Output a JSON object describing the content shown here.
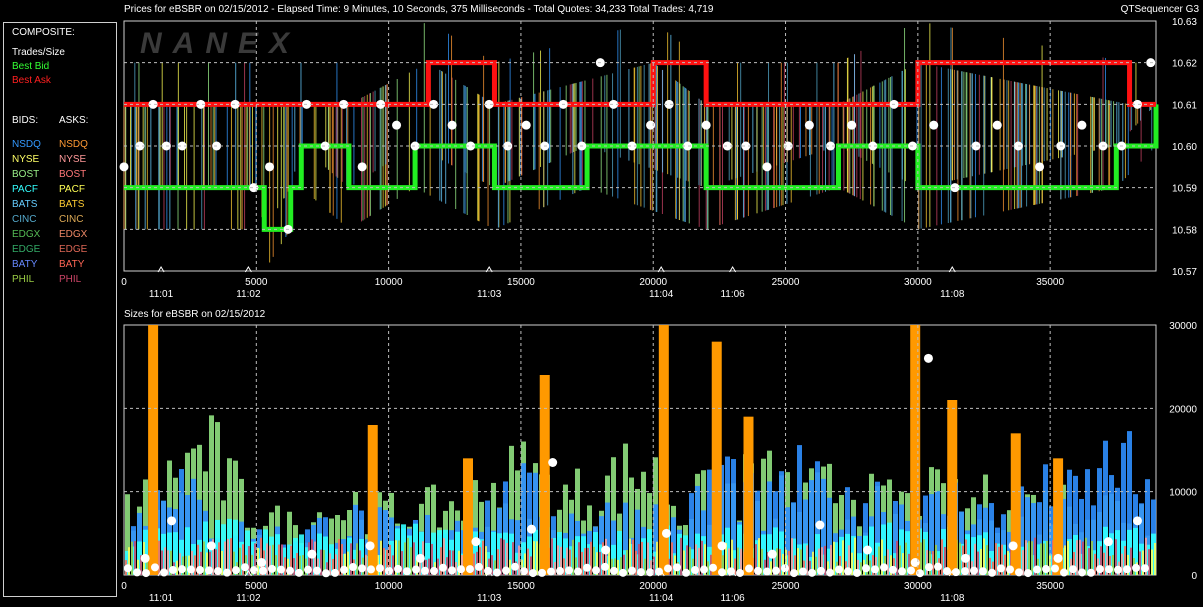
{
  "legend": {
    "composite_title": "COMPOSITE:",
    "items": [
      {
        "label": "Trades/Size",
        "color": "#ffffff"
      },
      {
        "label": "Best Bid",
        "color": "#33ff33"
      },
      {
        "label": "Best Ask",
        "color": "#ff2020"
      }
    ],
    "bids_title": "BIDS:",
    "asks_title": "ASKS:",
    "bids": [
      {
        "label": "NSDQ",
        "color": "#3399ff"
      },
      {
        "label": "NYSE",
        "color": "#ffff66"
      },
      {
        "label": "BOST",
        "color": "#99ee88"
      },
      {
        "label": "PACF",
        "color": "#33ffff"
      },
      {
        "label": "BATS",
        "color": "#66ccff"
      },
      {
        "label": "CINC",
        "color": "#55aacc"
      },
      {
        "label": "EDGX",
        "color": "#55bb55"
      },
      {
        "label": "EDGE",
        "color": "#33aa66"
      },
      {
        "label": "BATY",
        "color": "#6688ff"
      },
      {
        "label": "PHIL",
        "color": "#99cc44"
      }
    ],
    "asks": [
      {
        "label": "NSDQ",
        "color": "#ff9933"
      },
      {
        "label": "NYSE",
        "color": "#ff9999"
      },
      {
        "label": "BOST",
        "color": "#ff7777"
      },
      {
        "label": "PACF",
        "color": "#ffff55"
      },
      {
        "label": "BATS",
        "color": "#ffcc33"
      },
      {
        "label": "CINC",
        "color": "#ddaa55"
      },
      {
        "label": "EDGX",
        "color": "#ee8866"
      },
      {
        "label": "EDGE",
        "color": "#dd6655"
      },
      {
        "label": "BATY",
        "color": "#ff6655"
      },
      {
        "label": "PHIL",
        "color": "#cc4466"
      }
    ]
  },
  "header": {
    "title": "Prices for  eBSBR  on  02/15/2012  -  Elapsed Time: 9 Minutes, 10 Seconds, 375 Milliseconds  -  Total Quotes: 34,233  Total Trades: 4,719",
    "brand": "QTSequencer G3",
    "watermark": "NANEX"
  },
  "sizes_title": "Sizes for  eBSBR  on  02/15/2012",
  "colors": {
    "grid": "#bdbdbd",
    "best_bid": "#22ee22",
    "best_ask": "#ff1111",
    "trade": "#ffffff",
    "orange": "#ff9900"
  },
  "chart_data": [
    {
      "type": "line",
      "title": "Prices for eBSBR on 02/15/2012",
      "xlim": [
        0,
        39000
      ],
      "ylim": [
        10.57,
        10.63
      ],
      "x_ticks": [
        0,
        5000,
        10000,
        15000,
        20000,
        25000,
        30000,
        35000
      ],
      "x_tick_labels": [
        "0",
        "5000",
        "10000",
        "15000",
        "20000",
        "25000",
        "30000",
        "35000"
      ],
      "time_ticks": [
        {
          "x": 1400,
          "label": "11:01"
        },
        {
          "x": 4700,
          "label": "11:02"
        },
        {
          "x": 13800,
          "label": "11:03"
        },
        {
          "x": 20300,
          "label": "11:04"
        },
        {
          "x": 23000,
          "label": "11:06"
        },
        {
          "x": 31300,
          "label": "11:08"
        }
      ],
      "y_ticks": [
        10.57,
        10.58,
        10.59,
        10.6,
        10.61,
        10.62,
        10.63
      ],
      "y_tick_labels": [
        "10.57",
        "10.58",
        "10.59",
        "10.60",
        "10.61",
        "10.62",
        "10.63"
      ],
      "grid": true,
      "series": [
        {
          "name": "Best Bid",
          "x": [
            0,
            5000,
            5300,
            6300,
            6700,
            8500,
            11000,
            14000,
            17500,
            22000,
            27000,
            30000,
            37500,
            39000
          ],
          "y": [
            10.59,
            10.59,
            10.58,
            10.59,
            10.6,
            10.59,
            10.6,
            10.59,
            10.6,
            10.59,
            10.6,
            10.59,
            10.6,
            10.61
          ]
        },
        {
          "name": "Best Ask",
          "x": [
            0,
            6500,
            8500,
            11500,
            14000,
            20000,
            22000,
            27000,
            30000,
            38000,
            39000
          ],
          "y": [
            10.61,
            10.61,
            10.61,
            10.62,
            10.61,
            10.62,
            10.61,
            10.61,
            10.62,
            10.61,
            10.61
          ]
        },
        {
          "name": "Trades/Size",
          "x": [
            0,
            600,
            1100,
            1600,
            2200,
            2900,
            3500,
            4200,
            4900,
            5500,
            6200,
            6900,
            7600,
            8300,
            9000,
            9700,
            10300,
            11000,
            11700,
            12400,
            13100,
            13800,
            14500,
            15200,
            15900,
            16600,
            17300,
            18000,
            18500,
            19200,
            19900,
            20600,
            21300,
            22000,
            22800,
            23500,
            24300,
            25100,
            25900,
            26700,
            27500,
            28300,
            29100,
            29800,
            30600,
            31400,
            32200,
            33000,
            33800,
            34600,
            35400,
            36200,
            37000,
            37700,
            38300,
            38800
          ],
          "y": [
            10.595,
            10.6,
            10.61,
            10.6,
            10.6,
            10.61,
            10.6,
            10.61,
            10.59,
            10.595,
            10.58,
            10.61,
            10.6,
            10.61,
            10.595,
            10.61,
            10.605,
            10.6,
            10.61,
            10.605,
            10.6,
            10.61,
            10.6,
            10.605,
            10.6,
            10.61,
            10.6,
            10.62,
            10.61,
            10.6,
            10.605,
            10.61,
            10.6,
            10.605,
            10.6,
            10.6,
            10.595,
            10.6,
            10.605,
            10.6,
            10.605,
            10.6,
            10.61,
            10.6,
            10.605,
            10.59,
            10.6,
            10.605,
            10.6,
            10.595,
            10.6,
            10.605,
            10.6,
            10.6,
            10.61,
            10.62
          ]
        }
      ]
    },
    {
      "type": "bar",
      "title": "Sizes for eBSBR on 02/15/2012",
      "xlim": [
        0,
        39000
      ],
      "ylim": [
        0,
        30000
      ],
      "x_ticks": [
        0,
        5000,
        10000,
        15000,
        20000,
        25000,
        30000,
        35000
      ],
      "x_tick_labels": [
        "0",
        "5000",
        "10000",
        "15000",
        "20000",
        "25000",
        "30000",
        "35000"
      ],
      "time_ticks": [
        {
          "x": 1400,
          "label": "11:01"
        },
        {
          "x": 4700,
          "label": "11:02"
        },
        {
          "x": 13800,
          "label": "11:03"
        },
        {
          "x": 20300,
          "label": "11:04"
        },
        {
          "x": 23000,
          "label": "11:06"
        },
        {
          "x": 31300,
          "label": "11:08"
        }
      ],
      "y_ticks": [
        0,
        10000,
        20000,
        30000
      ],
      "y_tick_labels": [
        "0",
        "10000",
        "20000",
        "30000"
      ],
      "grid": true,
      "series": [
        {
          "name": "NSDQ",
          "x": [
            0,
            1500,
            3000,
            4500,
            6000,
            7500,
            9000,
            10500,
            12000,
            13500,
            15000,
            16500,
            18000,
            19500,
            21000,
            22500,
            24000,
            25500,
            27000,
            28500,
            30000,
            31500,
            33000,
            34500,
            36000,
            37500,
            38800
          ],
          "y": [
            5000,
            16000,
            8000,
            6000,
            5500,
            7000,
            8000,
            6000,
            7500,
            9000,
            12000,
            8000,
            8500,
            9000,
            7000,
            16000,
            9000,
            14000,
            9000,
            12000,
            9000,
            11000,
            8000,
            12000,
            11000,
            18000,
            9000
          ]
        },
        {
          "name": "BOST",
          "x": [
            0,
            1500,
            3000,
            4500,
            6000,
            7500,
            9000,
            10500,
            12000,
            13500,
            15000,
            16500,
            18000,
            19500,
            21000,
            22500,
            24000,
            25500,
            27000,
            28500,
            30000,
            31500,
            33000,
            34500,
            36000,
            37500,
            38800
          ],
          "y": [
            9000,
            13000,
            19000,
            10000,
            7000,
            9000,
            11000,
            8000,
            10000,
            12000,
            15000,
            11000,
            13000,
            16000,
            10000,
            12000,
            14000,
            11000,
            13000,
            10000,
            12000,
            10000,
            11000,
            10000,
            11000,
            10000,
            9000
          ]
        },
        {
          "name": "PACF",
          "x": [
            0,
            1500,
            3000,
            4500,
            6000,
            7500,
            9000,
            10500,
            12000,
            13500,
            15000,
            16500,
            18000,
            19500,
            21000,
            22500,
            24000,
            25500,
            27000,
            28500,
            30000,
            31500,
            33000,
            34500,
            36000,
            37500,
            38800
          ],
          "y": [
            5000,
            5500,
            7000,
            6500,
            4000,
            5000,
            4000,
            6000,
            5000,
            4500,
            5000,
            5500,
            4500,
            5000,
            6000,
            5500,
            5000,
            5000,
            4000,
            6000,
            5000,
            5500,
            5000,
            4500,
            5000,
            5500,
            5000
          ]
        },
        {
          "name": "NSDQ ask",
          "x": [
            1100,
            9400,
            13000,
            15900,
            20400,
            22400,
            23600,
            29900,
            31300,
            33700,
            35300
          ],
          "y": [
            30000,
            18000,
            14000,
            24000,
            30000,
            28000,
            19000,
            30000,
            21000,
            17000,
            14000
          ]
        },
        {
          "name": "Trades/Size",
          "x": [
            800,
            1800,
            3300,
            5200,
            7100,
            9300,
            11200,
            13300,
            15400,
            16200,
            18200,
            20500,
            22600,
            24500,
            26300,
            28100,
            29900,
            30400,
            31800,
            33600,
            35300,
            37200,
            38300
          ],
          "y": [
            2000,
            6500,
            3500,
            1500,
            2500,
            3500,
            2000,
            4000,
            5500,
            13500,
            3000,
            5000,
            3500,
            2500,
            6000,
            3000,
            1500,
            26000,
            2000,
            3500,
            2000,
            4000,
            6500
          ]
        }
      ]
    }
  ]
}
